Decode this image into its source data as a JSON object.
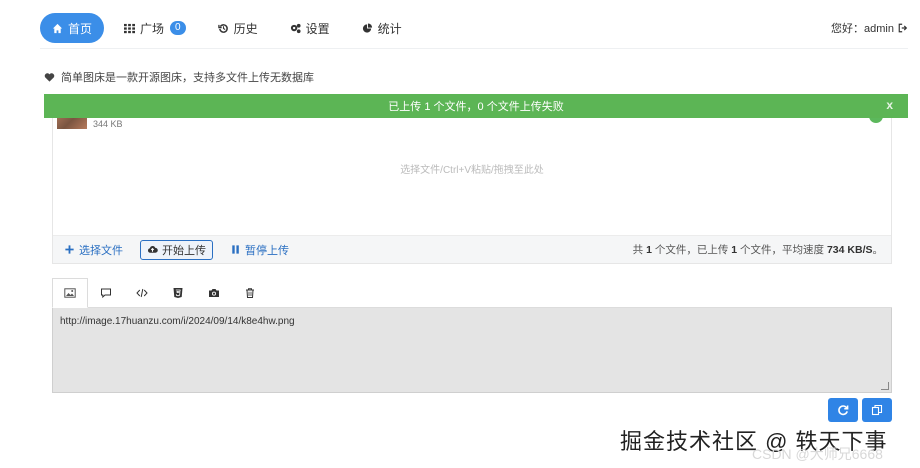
{
  "nav": {
    "items": [
      {
        "label": "首页",
        "icon": "home-icon",
        "active": true
      },
      {
        "label": "广场",
        "icon": "grid-icon",
        "badge": "0"
      },
      {
        "label": "历史",
        "icon": "history-icon"
      },
      {
        "label": "设置",
        "icon": "gears-icon"
      },
      {
        "label": "统计",
        "icon": "pie-chart-icon"
      }
    ],
    "greeting": "您好：admin"
  },
  "intro": "简单图床是一款开源图床，支持多文件上传无数据库",
  "alert": {
    "text": "已上传 1 个文件，0 个文件上传失败",
    "close": "x",
    "color": "#5cb555"
  },
  "uploader": {
    "file_size": "344 KB",
    "drop_hint": "选择文件/Ctrl+V粘贴/拖拽至此处",
    "buttons": {
      "select": "选择文件",
      "start": "开始上传",
      "pause": "暂停上传"
    },
    "stats": {
      "prefix": "共",
      "total": "1",
      "mid": "个文件，已上传",
      "uploaded": "1",
      "suffix": "个文件，平均速度",
      "speed": "734 KB/S",
      "end": "。"
    }
  },
  "output": {
    "tabs": [
      "image-icon",
      "comment-icon",
      "code-icon",
      "html5-icon",
      "camera-icon",
      "trash-icon"
    ],
    "value": "http://image.17huanzu.com/i/2024/09/14/k8e4hw.png"
  },
  "actions": {
    "accent": "#2f84e6"
  },
  "watermark": {
    "main": "掘金技术社区 @ 轶天下事",
    "sub": "CSDN @大师兄6668"
  }
}
